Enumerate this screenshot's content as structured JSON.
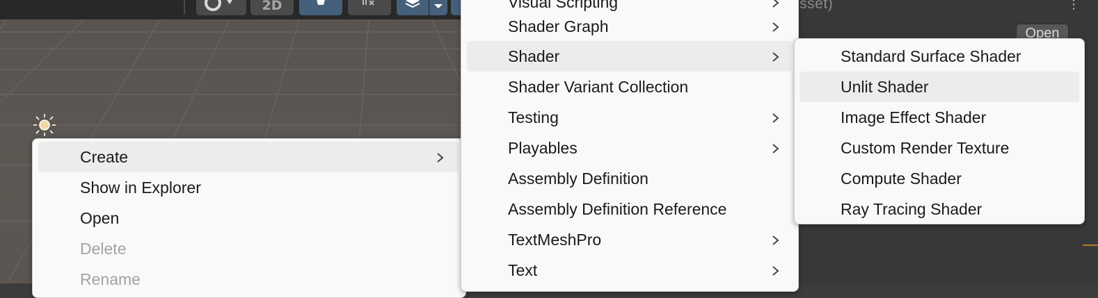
{
  "toolbar": {
    "mode_2d_label": "2D",
    "buttons": [
      {
        "name": "shading-mode",
        "icon": "circle-icon"
      },
      {
        "name": "2d-toggle",
        "label": "2D"
      },
      {
        "name": "lighting-toggle",
        "icon": "lightbulb-icon",
        "active": true
      },
      {
        "name": "audio-toggle",
        "icon": "audio-mute-icon"
      },
      {
        "name": "effects-toggle",
        "icon": "layers-icon",
        "active": true
      }
    ]
  },
  "inspector": {
    "title": "it Asset)",
    "open_label": "Open"
  },
  "context_menu": {
    "items": [
      {
        "label": "Create",
        "submenu": true,
        "highlighted": true
      },
      {
        "label": "Show in Explorer"
      },
      {
        "label": "Open"
      },
      {
        "label": "Delete",
        "disabled": true
      },
      {
        "label": "Rename",
        "disabled": true
      }
    ]
  },
  "create_menu": {
    "items": [
      {
        "label": "Visual Scripting",
        "submenu": true
      },
      {
        "label": "Shader Graph",
        "submenu": true
      },
      {
        "label": "Shader",
        "submenu": true,
        "highlighted": true
      },
      {
        "label": "Shader Variant Collection"
      },
      {
        "label": "Testing",
        "submenu": true
      },
      {
        "label": "Playables",
        "submenu": true
      },
      {
        "label": "Assembly Definition"
      },
      {
        "label": "Assembly Definition Reference"
      },
      {
        "label": "TextMeshPro",
        "submenu": true
      },
      {
        "label": "Text",
        "submenu": true
      }
    ]
  },
  "shader_menu": {
    "items": [
      {
        "label": "Standard Surface Shader"
      },
      {
        "label": "Unlit Shader",
        "highlighted": true
      },
      {
        "label": "Image Effect Shader"
      },
      {
        "label": "Custom Render Texture"
      },
      {
        "label": "Compute Shader"
      },
      {
        "label": "Ray Tracing Shader"
      }
    ]
  },
  "colors": {
    "menu_bg": "#f9f9f9",
    "highlight": "#ececec",
    "active_button": "#46607c",
    "disabled_text": "#a3a3a3"
  }
}
